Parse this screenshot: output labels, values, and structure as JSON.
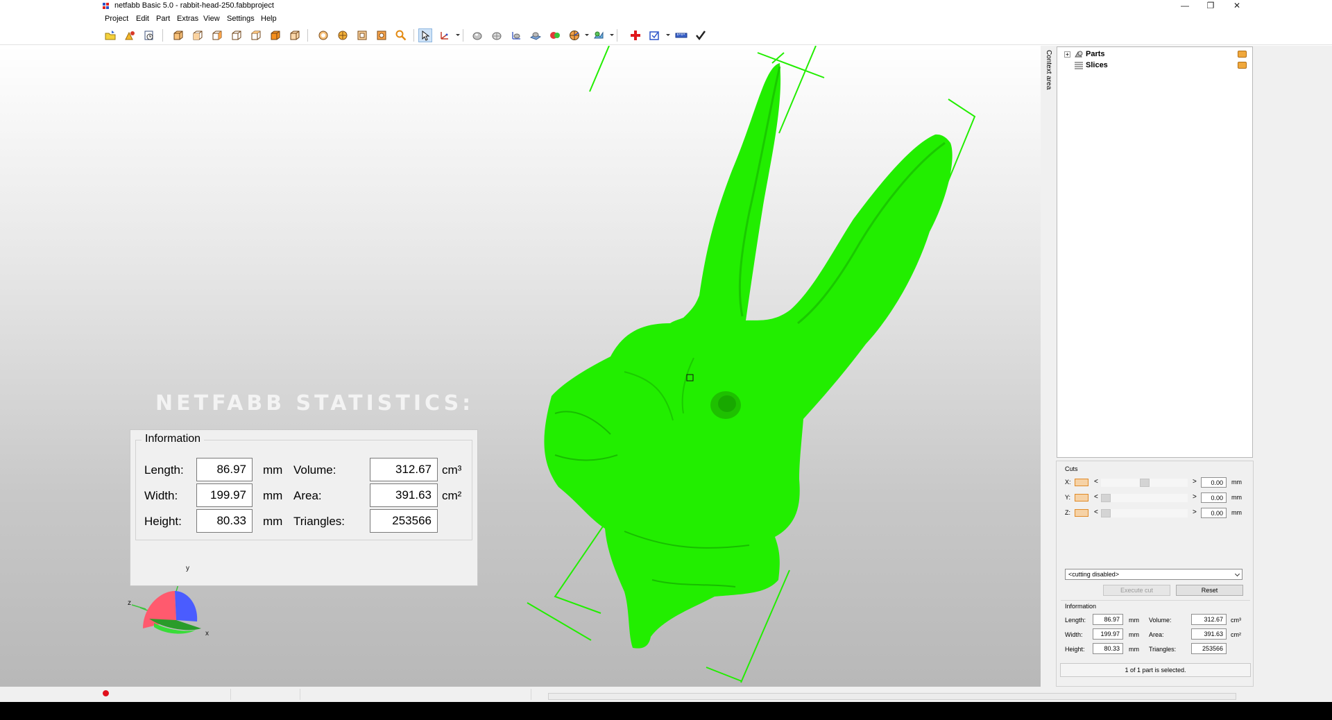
{
  "window": {
    "title": "netfabb Basic 5.0 - rabbit-head-250.fabbproject",
    "controls": {
      "minimize": "—",
      "maximize": "❐",
      "close": "✕"
    }
  },
  "menu": [
    "Project",
    "Edit",
    "Part",
    "Extras",
    "View",
    "Settings",
    "Help"
  ],
  "toolbar": {
    "icons": [
      "open-project-icon",
      "add-part-icon",
      "export-icon",
      "view-top-icon",
      "view-bottom-icon",
      "view-front-icon",
      "view-back-icon",
      "view-left-icon",
      "view-right-icon",
      "rotate-view-icon",
      "pan-view-icon",
      "zoom-extents-icon",
      "zoom-selection-icon",
      "zoom-icon",
      "select-tool-icon",
      "measure-tool-icon",
      "sphere-shading-icon",
      "wireframe-icon",
      "axis-display-icon",
      "plane-display-icon",
      "color-icon",
      "camera-icon",
      "settings-view-icon",
      "repair-cross-icon",
      "ruler-box-icon",
      "ruler-icon",
      "check-mark-icon"
    ],
    "active": "select-tool-icon"
  },
  "viewport": {
    "overlay_title": "NETFABB STATISTICS:",
    "info_box": {
      "legend": "Information",
      "length_label": "Length:",
      "length": "86.97",
      "length_unit": "mm",
      "width_label": "Width:",
      "width": "199.97",
      "width_unit": "mm",
      "height_label": "Height:",
      "height": "80.33",
      "height_unit": "mm",
      "volume_label": "Volume:",
      "volume": "312.67",
      "volume_unit": "cm³",
      "area_label": "Area:",
      "area": "391.63",
      "area_unit": "cm²",
      "triangles_label": "Triangles:",
      "triangles": "253566"
    },
    "axes": {
      "x": "x",
      "y": "y",
      "z": "z"
    },
    "colors": {
      "model": "#22ee00",
      "bounding_box": "#22ee00",
      "axis_x": "#ff5a6e",
      "axis_y": "#2a9c2a",
      "axis_z": "#4a5cff"
    }
  },
  "side_strip": {
    "label": "Context area"
  },
  "project_tree": {
    "items": [
      {
        "label": "Parts",
        "expander": "+"
      },
      {
        "label": "Slices",
        "expander": ""
      }
    ]
  },
  "cuts": {
    "title": "Cuts",
    "rows": [
      {
        "axis": "X:",
        "value": "0.00",
        "unit": "mm",
        "position": 0.5
      },
      {
        "axis": "Y:",
        "value": "0.00",
        "unit": "mm",
        "position": 0.0
      },
      {
        "axis": "Z:",
        "value": "0.00",
        "unit": "mm",
        "position": 0.0
      }
    ],
    "less": "<",
    "more": ">",
    "mode": "<cutting disabled>",
    "execute_label": "Execute cut",
    "reset_label": "Reset"
  },
  "info_panel": {
    "title": "Information",
    "length_label": "Length:",
    "length": "86.97",
    "length_unit": "mm",
    "width_label": "Width:",
    "width": "199.97",
    "width_unit": "mm",
    "height_label": "Height:",
    "height": "80.33",
    "height_unit": "mm",
    "volume_label": "Volume:",
    "volume": "312.67",
    "volume_unit": "cm³",
    "area_label": "Area:",
    "area": "391.63",
    "area_unit": "cm²",
    "triangles_label": "Triangles:",
    "triangles": "253566"
  },
  "selection_status": "1 of 1 part is selected."
}
